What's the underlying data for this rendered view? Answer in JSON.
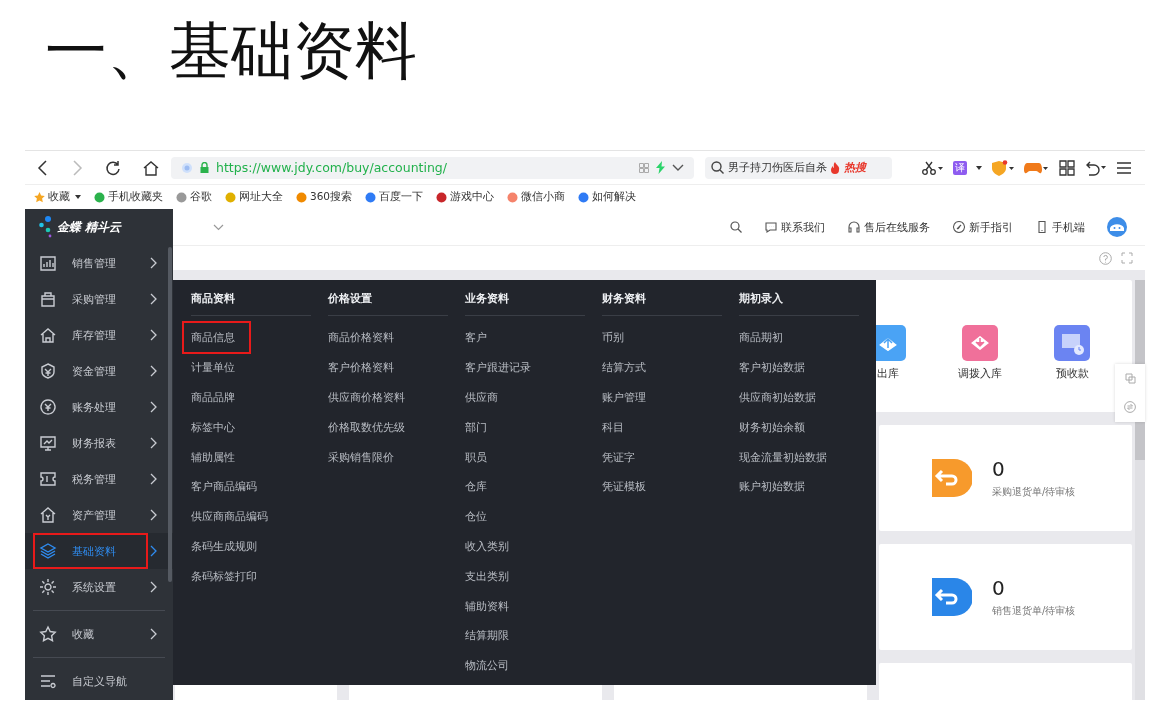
{
  "slide_title": "一、基础资料",
  "browser": {
    "url": "https://www.jdy.com/buy/accounting/",
    "search_text": "男子持刀伤医后自杀",
    "search_badge": "热搜",
    "translate_label": "译",
    "bookmarks": [
      "收藏",
      "手机收藏夹",
      "谷歌",
      "网址大全",
      "360搜索",
      "百度一下",
      "游戏中心",
      "微信小商",
      "如何解决"
    ]
  },
  "app": {
    "logo": "金蝶 精斗云",
    "sidebar_items": [
      {
        "label": "销售管理",
        "selected": false,
        "outlined": false
      },
      {
        "label": "采购管理",
        "selected": false,
        "outlined": false
      },
      {
        "label": "库存管理",
        "selected": false,
        "outlined": false
      },
      {
        "label": "资金管理",
        "selected": false,
        "outlined": false
      },
      {
        "label": "账务处理",
        "selected": false,
        "outlined": false
      },
      {
        "label": "财务报表",
        "selected": false,
        "outlined": false
      },
      {
        "label": "税务管理",
        "selected": false,
        "outlined": false
      },
      {
        "label": "资产管理",
        "selected": false,
        "outlined": false
      },
      {
        "label": "基础资料",
        "selected": true,
        "outlined": true
      },
      {
        "label": "系统设置",
        "selected": false,
        "outlined": false
      }
    ],
    "favorites": "收藏",
    "custom_nav": "自定义导航",
    "header_links": [
      "联系我们",
      "售后在线服务",
      "新手指引",
      "手机端"
    ],
    "mega_menu": [
      {
        "title": "商品资料",
        "items": [
          {
            "label": "商品信息",
            "outlined": true
          },
          {
            "label": "计量单位",
            "outlined": false
          },
          {
            "label": "商品品牌",
            "outlined": false
          },
          {
            "label": "标签中心",
            "outlined": false
          },
          {
            "label": "辅助属性",
            "outlined": false
          },
          {
            "label": "客户商品编码",
            "outlined": false
          },
          {
            "label": "供应商商品编码",
            "outlined": false
          },
          {
            "label": "条码生成规则",
            "outlined": false
          },
          {
            "label": "条码标签打印",
            "outlined": false
          }
        ]
      },
      {
        "title": "价格设置",
        "items": [
          {
            "label": "商品价格资料",
            "outlined": false
          },
          {
            "label": "客户价格资料",
            "outlined": false
          },
          {
            "label": "供应商价格资料",
            "outlined": false
          },
          {
            "label": "价格取数优先级",
            "outlined": false
          },
          {
            "label": "采购销售限价",
            "outlined": false
          }
        ]
      },
      {
        "title": "业务资料",
        "items": [
          {
            "label": "客户",
            "outlined": false
          },
          {
            "label": "客户跟进记录",
            "outlined": false
          },
          {
            "label": "供应商",
            "outlined": false
          },
          {
            "label": "部门",
            "outlined": false
          },
          {
            "label": "职员",
            "outlined": false
          },
          {
            "label": "仓库",
            "outlined": false
          },
          {
            "label": "仓位",
            "outlined": false
          },
          {
            "label": "收入类别",
            "outlined": false
          },
          {
            "label": "支出类别",
            "outlined": false
          },
          {
            "label": "辅助资料",
            "outlined": false
          },
          {
            "label": "结算期限",
            "outlined": false
          },
          {
            "label": "物流公司",
            "outlined": false
          }
        ]
      },
      {
        "title": "财务资料",
        "items": [
          {
            "label": "币别",
            "outlined": false
          },
          {
            "label": "结算方式",
            "outlined": false
          },
          {
            "label": "账户管理",
            "outlined": false
          },
          {
            "label": "科目",
            "outlined": false
          },
          {
            "label": "凭证字",
            "outlined": false
          },
          {
            "label": "凭证模板",
            "outlined": false
          }
        ]
      },
      {
        "title": "期初录入",
        "items": [
          {
            "label": "商品期初",
            "outlined": false
          },
          {
            "label": "客户初始数据",
            "outlined": false
          },
          {
            "label": "供应商初始数据",
            "outlined": false
          },
          {
            "label": "财务初始余额",
            "outlined": false
          },
          {
            "label": "现金流量初始数据",
            "outlined": false
          },
          {
            "label": "账户初始数据",
            "outlined": false
          }
        ]
      }
    ],
    "shortcuts": [
      "出库",
      "调拨入库",
      "预收款"
    ],
    "stat_cards": [
      {
        "value": "0",
        "label": "采购退货单/待审核",
        "color": "#f79a2c"
      },
      {
        "value": "0",
        "label": "销售退货单/待审核",
        "color": "#2a86e8"
      }
    ]
  }
}
